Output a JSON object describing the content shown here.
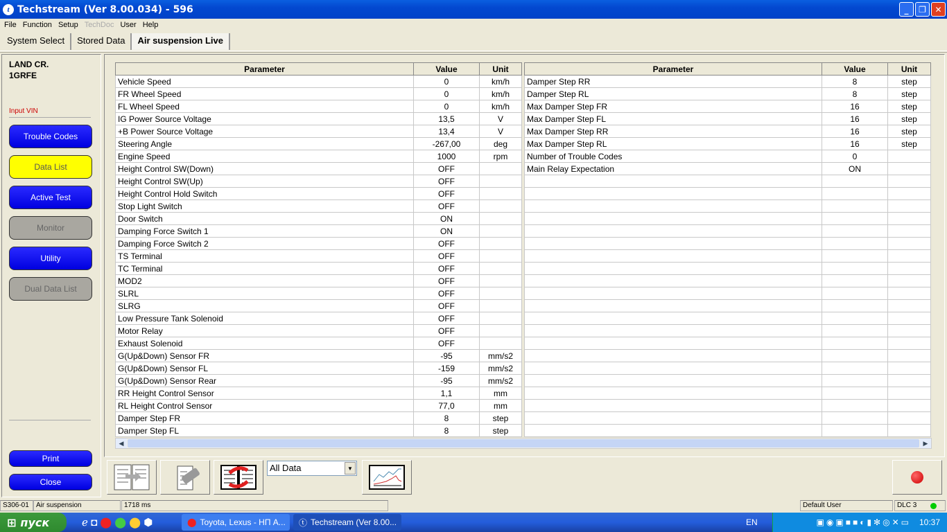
{
  "window": {
    "title": "Techstream (Ver 8.00.034) - 596"
  },
  "menu": [
    "File",
    "Function",
    "Setup",
    "TechDoc",
    "User",
    "Help"
  ],
  "tabs": [
    "System Select",
    "Stored Data",
    "Air suspension Live"
  ],
  "vehicle": {
    "model": "LAND CR.",
    "engine": "1GRFE",
    "input_vin": "Input VIN"
  },
  "nav": [
    {
      "label": "Trouble Codes",
      "state": "blue"
    },
    {
      "label": "Data List",
      "state": "active"
    },
    {
      "label": "Active Test",
      "state": "blue"
    },
    {
      "label": "Monitor",
      "state": "disabled"
    },
    {
      "label": "Utility",
      "state": "blue"
    },
    {
      "label": "Dual Data List",
      "state": "disabled"
    }
  ],
  "print_label": "Print",
  "close_label": "Close",
  "headers": {
    "parameter": "Parameter",
    "value": "Value",
    "unit": "Unit"
  },
  "left_rows": [
    [
      "Vehicle Speed",
      "0",
      "km/h"
    ],
    [
      "FR Wheel Speed",
      "0",
      "km/h"
    ],
    [
      "FL Wheel Speed",
      "0",
      "km/h"
    ],
    [
      "IG Power Source Voltage",
      "13,5",
      "V"
    ],
    [
      "+B Power Source Voltage",
      "13,4",
      "V"
    ],
    [
      "Steering Angle",
      "-267,00",
      "deg"
    ],
    [
      "Engine Speed",
      "1000",
      "rpm"
    ],
    [
      "Height Control SW(Down)",
      "OFF",
      ""
    ],
    [
      "Height Control SW(Up)",
      "OFF",
      ""
    ],
    [
      "Height Control Hold Switch",
      "OFF",
      ""
    ],
    [
      "Stop Light Switch",
      "OFF",
      ""
    ],
    [
      "Door Switch",
      "ON",
      ""
    ],
    [
      "Damping Force Switch 1",
      "ON",
      ""
    ],
    [
      "Damping Force Switch 2",
      "OFF",
      ""
    ],
    [
      "TS Terminal",
      "OFF",
      ""
    ],
    [
      "TC Terminal",
      "OFF",
      ""
    ],
    [
      "MOD2",
      "OFF",
      ""
    ],
    [
      "SLRL",
      "OFF",
      ""
    ],
    [
      "SLRG",
      "OFF",
      ""
    ],
    [
      "Low Pressure Tank Solenoid",
      "OFF",
      ""
    ],
    [
      "Motor Relay",
      "OFF",
      ""
    ],
    [
      "Exhaust Solenoid",
      "OFF",
      ""
    ],
    [
      "G(Up&Down) Sensor FR",
      "-95",
      "mm/s2"
    ],
    [
      "G(Up&Down) Sensor FL",
      "-159",
      "mm/s2"
    ],
    [
      "G(Up&Down) Sensor Rear",
      "-95",
      "mm/s2"
    ],
    [
      "RR Height Control Sensor",
      "1,1",
      "mm"
    ],
    [
      "RL Height Control Sensor",
      "77,0",
      "mm"
    ],
    [
      "Damper Step FR",
      "8",
      "step"
    ],
    [
      "Damper Step FL",
      "8",
      "step"
    ]
  ],
  "right_rows": [
    [
      "Damper Step RR",
      "8",
      "step"
    ],
    [
      "Damper Step RL",
      "8",
      "step"
    ],
    [
      "Max Damper Step FR",
      "16",
      "step"
    ],
    [
      "Max Damper Step FL",
      "16",
      "step"
    ],
    [
      "Max Damper Step RR",
      "16",
      "step"
    ],
    [
      "Max Damper Step RL",
      "16",
      "step"
    ],
    [
      "Number of Trouble Codes",
      "0",
      ""
    ],
    [
      "Main Relay Expectation",
      "ON",
      ""
    ]
  ],
  "filter_select": "All Data",
  "status": {
    "code": "S306-01",
    "system": "Air suspension",
    "interval": "1718 ms",
    "user": "Default User",
    "connection": "DLC 3",
    "connection_color": "#00cc00"
  },
  "taskbar": {
    "start": "пуск",
    "tasks": [
      "Toyota, Lexus - НП А...",
      "Techstream (Ver 8.00..."
    ],
    "lang": "EN",
    "clock": "10:37"
  }
}
